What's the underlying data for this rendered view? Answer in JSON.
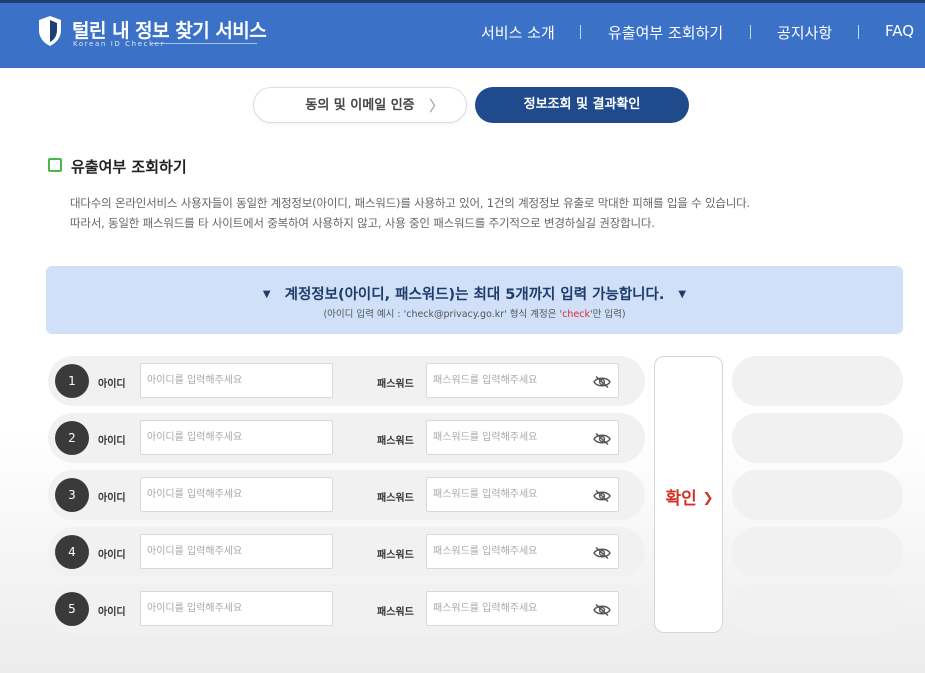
{
  "header": {
    "title": "털린 내 정보 찾기 서비스",
    "subtitle": "Korean ID Checker",
    "nav": [
      "서비스 소개",
      "유출여부 조회하기",
      "공지사항",
      "FAQ"
    ],
    "bg_color": "#3b72c7"
  },
  "steps": {
    "step1": "동의 및 이메일 인증",
    "step2": "정보조회 및 결과확인"
  },
  "section": {
    "title": "유출여부 조회하기",
    "desc_line1": "대다수의 온라인서비스 사용자들이 동일한 계정정보(아이디, 패스워드)를 사용하고 있어, 1건의 계정정보 유출로 막대한 피해를 입을 수 있습니다.",
    "desc_line2": "따라서, 동일한 패스워드를 타 사이트에서 중복하여 사용하지 않고, 사용 중인 패스워드를 주기적으로 변경하실길 권장합니다."
  },
  "banner": {
    "main": "계정정보(아이디, 패스워드)는 최대 5개까지 입력 가능합니다.",
    "sub_prefix": "(아이디 입력 예시 : 'check@privacy.go.kr' 형식 계정은 '",
    "sub_highlight": "check",
    "sub_suffix": "'만 입력)"
  },
  "form": {
    "id_label": "아이디",
    "pw_label": "패스워드",
    "id_placeholder": "아이디를 입력해주세요",
    "pw_placeholder": "패스워드를 입력해주세요",
    "rows": [
      {
        "num": "1"
      },
      {
        "num": "2"
      },
      {
        "num": "3"
      },
      {
        "num": "4"
      },
      {
        "num": "5"
      }
    ]
  },
  "confirm_button": "확인",
  "confirm_arrow": "❯",
  "icons": {
    "logo": "shield-icon",
    "step_arrow": "chevron-right-icon",
    "banner": "chevron-down-icon",
    "password": "eye-slash-icon"
  }
}
